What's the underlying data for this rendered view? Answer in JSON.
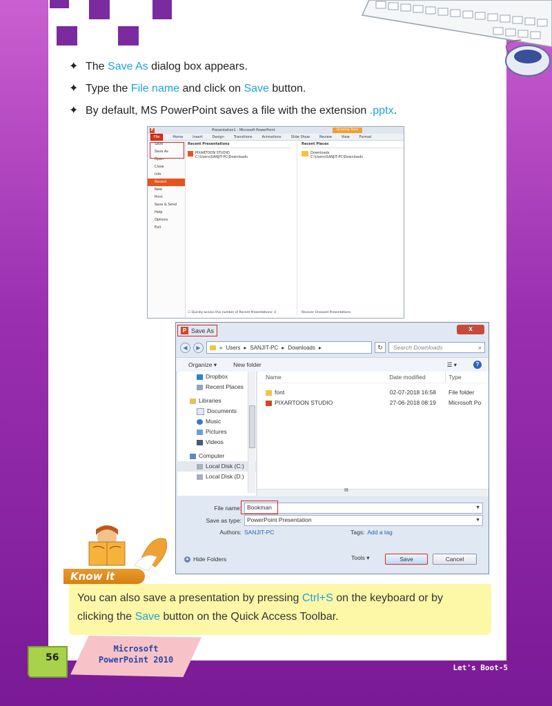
{
  "bullets": [
    {
      "pre": "The ",
      "hl": "Save As",
      "post": " dialog box appears."
    },
    {
      "pre": "Type the ",
      "hl": "File name",
      "mid": " and click on ",
      "hl2": "Save",
      "post": " button."
    },
    {
      "pre": "By default, MS PowerPoint saves a file with the extension ",
      "hl": ".pptx",
      "post": "."
    }
  ],
  "backstage": {
    "title": "Presentation1 - Microsoft PowerPoint",
    "drawing_tools": "Drawing Tools",
    "tabs": [
      "File",
      "Home",
      "Insert",
      "Design",
      "Transitions",
      "Animations",
      "Slide Show",
      "Review",
      "View",
      "Format"
    ],
    "side": [
      "Save",
      "Save As",
      "Open",
      "Close",
      "Info",
      "Recent",
      "New",
      "Print",
      "Save & Send",
      "Help",
      "Options",
      "Exit"
    ],
    "recent_pres_heading": "Recent Presentations",
    "recent_file_name": "PIXARTOON STUDIO",
    "recent_file_path": "C:\\Users\\SANJIT-PC\\Downloads",
    "recent_places_heading": "Recent Places",
    "place_name": "Downloads",
    "place_path": "C:\\Users\\SANJIT-PC\\Downloads",
    "quick_access": "Quickly access this number of Recent Presentations:",
    "quick_count": "4",
    "recover": "Recover Unsaved Presentations"
  },
  "dialog": {
    "title": "Save As",
    "close": "x",
    "crumbs": [
      "«",
      "Users",
      "▸",
      "SANJIT-PC",
      "▸",
      "Downloads",
      "▸"
    ],
    "search_placeholder": "Search Downloads",
    "organize": "Organize ▾",
    "new_folder": "New folder",
    "nav": [
      "Dropbox",
      "Recent Places",
      "Libraries",
      "Documents",
      "Music",
      "Pictures",
      "Videos",
      "Computer",
      "Local Disk (C:)",
      "Local Disk (D:)"
    ],
    "col_name": "Name",
    "col_date": "Date modified",
    "col_type": "Type",
    "files": [
      {
        "name": "font",
        "date": "02-07-2018 16:58",
        "type": "File folder"
      },
      {
        "name": "PIXARTOON STUDIO",
        "date": "27-06-2018 08:19",
        "type": "Microsoft Po"
      }
    ],
    "hscroll_mark": "III",
    "file_name_label": "File name:",
    "file_name_value": "Bookman",
    "save_type_label": "Save as type:",
    "save_type_value": "PowerPoint Presentation",
    "authors_label": "Authors:",
    "authors_value": "SANJIT-PC",
    "tags_label": "Tags:",
    "tags_value": "Add a tag",
    "hide_folders": "Hide Folders",
    "tools": "Tools",
    "save": "Save",
    "cancel": "Cancel"
  },
  "know_it": {
    "label": "Know it",
    "line1_pre": "You can also save a presentation by pressing ",
    "line1_hl": "Ctrl+S",
    "line1_post": " on the keyboard or by",
    "line2_pre": "clicking the ",
    "line2_hl": "Save",
    "line2_post": " button on the Quick Access Toolbar."
  },
  "footer": {
    "page": "56",
    "title1": "Microsoft",
    "title2": "PowerPoint 2010",
    "series": "Let's Boot-5"
  },
  "colors": {
    "highlight": "#1ea2d9",
    "purple": "#9a2fb0",
    "accent_red": "#e02020"
  }
}
